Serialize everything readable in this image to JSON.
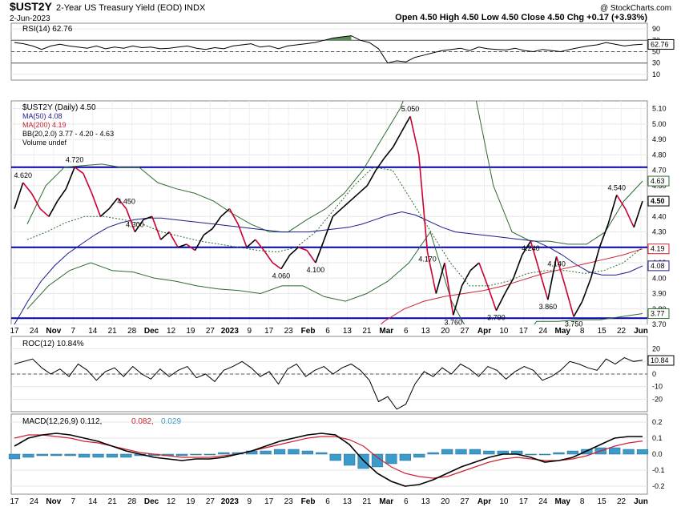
{
  "header": {
    "symbol": "$UST2Y",
    "name": "2-Year US Treasury Yield (EOD)",
    "exchange": "INDX",
    "date": "2-Jun-2023",
    "watermark": "@ StockCharts.com",
    "ohlc": "Open 4.50  High 4.50  Low 4.50  Close 4.50  Chg +0.17 (+3.93%)"
  },
  "legend": {
    "rsi": "RSI(14) 62.76",
    "price": "$UST2Y (Daily) 4.50",
    "ma50": "MA(50) 4.08",
    "ma200": "MA(200) 4.19",
    "bb": "BB(20,2.0) 3.77 - 4.20 - 4.63",
    "volume": "Volume undef",
    "roc": "ROC(12) 10.84%",
    "macd_label": "MACD(12,26,9) 0.112,",
    "macd_signal_val": "0.082,",
    "macd_hist_val": "0.029"
  },
  "colors": {
    "price": "#000000",
    "down": "#cc0033",
    "ma50": "#1a1a8c",
    "ma200": "#cc2233",
    "bb": "#2e6b2e",
    "hline": "#0000aa",
    "hist": "#3a9ccc",
    "rsi_fill": "#5a8a5a"
  },
  "x_axis": {
    "labels": [
      "17",
      "24",
      "Nov",
      "7",
      "14",
      "21",
      "28",
      "Dec",
      "12",
      "19",
      "27",
      "2023",
      "9",
      "17",
      "23",
      "Feb",
      "6",
      "13",
      "21",
      "Mar",
      "6",
      "13",
      "20",
      "27",
      "Apr",
      "10",
      "17",
      "24",
      "May",
      "8",
      "15",
      "22",
      "Jun"
    ],
    "bold": [
      "Nov",
      "Dec",
      "2023",
      "Feb",
      "Mar",
      "Apr",
      "May",
      "Jun"
    ]
  },
  "chart_data": [
    {
      "type": "line",
      "panel": "RSI",
      "y_ticks": [
        "90",
        "70",
        "50",
        "30",
        "10"
      ],
      "current": "62.76",
      "series": [
        {
          "name": "RSI(14)",
          "values": [
            66,
            64,
            60,
            54,
            60,
            63,
            60,
            58,
            56,
            60,
            55,
            58,
            56,
            60,
            57,
            58,
            55,
            56,
            58,
            60,
            56,
            54,
            57,
            55,
            60,
            62,
            64,
            58,
            60,
            55,
            60,
            62,
            64,
            66,
            70,
            74,
            76,
            78,
            70,
            66,
            55,
            30,
            34,
            32,
            40,
            44,
            48,
            52,
            54,
            56,
            52,
            58,
            55,
            54,
            53,
            56,
            52,
            50,
            54,
            52,
            50,
            54,
            57,
            60,
            62,
            66,
            63,
            60,
            62,
            63
          ]
        }
      ]
    },
    {
      "type": "line",
      "panel": "Price",
      "y_ticks": [
        "5.10",
        "5.00",
        "4.90",
        "4.80",
        "4.70",
        "4.60",
        "4.50",
        "4.40",
        "4.30",
        "4.20",
        "4.10",
        "4.00",
        "3.90",
        "3.80",
        "3.70"
      ],
      "ylim": [
        3.7,
        5.15
      ],
      "annotations": [
        {
          "text": "4.620",
          "y": 4.62
        },
        {
          "text": "4.720",
          "y": 4.72
        },
        {
          "text": "4.300",
          "y": 4.3
        },
        {
          "text": "4.450",
          "y": 4.45
        },
        {
          "text": "4.060",
          "y": 4.06
        },
        {
          "text": "5.050",
          "y": 5.05
        },
        {
          "text": "4.170",
          "y": 4.17
        },
        {
          "text": "4.100",
          "y": 4.1
        },
        {
          "text": "3.760",
          "y": 3.76
        },
        {
          "text": "3.790",
          "y": 3.79
        },
        {
          "text": "4.240",
          "y": 4.24
        },
        {
          "text": "4.140",
          "y": 4.14
        },
        {
          "text": "3.860",
          "y": 3.86
        },
        {
          "text": "3.750",
          "y": 3.75
        },
        {
          "text": "4.540",
          "y": 4.54
        }
      ],
      "horizontal_lines": [
        4.72,
        4.2,
        3.74
      ],
      "right_badges": [
        {
          "text": "4.63",
          "y": 4.63,
          "style": "bb"
        },
        {
          "text": "4.50",
          "y": 4.5,
          "style": "bold"
        },
        {
          "text": "4.19",
          "y": 4.19,
          "style": "ma200"
        },
        {
          "text": "4.08",
          "y": 4.08,
          "style": "ma50"
        },
        {
          "text": "3.77",
          "y": 3.77,
          "style": "bb"
        }
      ],
      "series": [
        {
          "name": "$UST2Y",
          "values": [
            4.45,
            4.62,
            4.55,
            4.45,
            4.4,
            4.5,
            4.58,
            4.72,
            4.68,
            4.55,
            4.4,
            4.45,
            4.52,
            4.45,
            4.3,
            4.38,
            4.4,
            4.25,
            4.3,
            4.2,
            4.22,
            4.18,
            4.28,
            4.32,
            4.4,
            4.45,
            4.35,
            4.2,
            4.25,
            4.18,
            4.1,
            4.06,
            4.15,
            4.2,
            4.18,
            4.1,
            4.25,
            4.4,
            4.45,
            4.5,
            4.55,
            4.6,
            4.7,
            4.78,
            4.85,
            4.95,
            5.05,
            4.8,
            4.17,
            3.9,
            4.1,
            3.76,
            3.95,
            4.05,
            4.1,
            3.95,
            3.79,
            3.9,
            4.0,
            4.15,
            4.24,
            4.05,
            3.86,
            4.14,
            3.95,
            3.75,
            3.85,
            4.0,
            4.2,
            4.35,
            4.54,
            4.45,
            4.33,
            4.5
          ]
        },
        {
          "name": "MA(50)",
          "values": [
            3.7,
            3.85,
            3.98,
            4.08,
            4.16,
            4.22,
            4.28,
            4.33,
            4.36,
            4.38,
            4.39,
            4.39,
            4.38,
            4.37,
            4.36,
            4.35,
            4.34,
            4.33,
            4.32,
            4.31,
            4.3,
            4.3,
            4.3,
            4.31,
            4.32,
            4.33,
            4.35,
            4.38,
            4.41,
            4.43,
            4.41,
            4.37,
            4.33,
            4.3,
            4.29,
            4.28,
            4.27,
            4.26,
            4.25,
            4.24,
            4.2,
            4.15,
            4.09,
            4.04,
            4.02,
            4.02,
            4.04,
            4.08
          ]
        },
        {
          "name": "MA(200)",
          "values": [
            3.6,
            3.72,
            3.8,
            3.85,
            3.88,
            3.9,
            3.92,
            3.95,
            3.99,
            4.03,
            4.06,
            4.09,
            4.12,
            4.15,
            4.19
          ]
        },
        {
          "name": "BB upper",
          "values": [
            4.35,
            4.6,
            4.72,
            4.73,
            4.74,
            4.72,
            4.72,
            4.62,
            4.58,
            4.55,
            4.5,
            4.42,
            4.35,
            4.3,
            4.3,
            4.38,
            4.45,
            4.55,
            4.7,
            4.9,
            5.1,
            5.4,
            5.6,
            5.5,
            5.2,
            4.6,
            4.3,
            4.24,
            4.24,
            4.22,
            4.22,
            4.3,
            4.5,
            4.63
          ]
        },
        {
          "name": "BB middle",
          "values": [
            4.25,
            4.3,
            4.36,
            4.4,
            4.4,
            4.38,
            4.35,
            4.3,
            4.27,
            4.24,
            4.22,
            4.2,
            4.18,
            4.17,
            4.2,
            4.3,
            4.45,
            4.6,
            4.72,
            4.7,
            4.5,
            4.3,
            4.1,
            3.95,
            3.95,
            3.98,
            4.03,
            4.05,
            4.05,
            4.03,
            4.05,
            4.1,
            4.2
          ]
        },
        {
          "name": "BB lower",
          "values": [
            3.8,
            3.95,
            4.05,
            4.1,
            4.05,
            4.04,
            4.0,
            3.98,
            3.95,
            3.93,
            3.92,
            3.9,
            3.95,
            3.95,
            3.88,
            3.85,
            3.9,
            3.98,
            4.1,
            4.3,
            3.85,
            3.6,
            3.4,
            3.5,
            3.72,
            3.72,
            3.73,
            3.73,
            3.75,
            3.77
          ]
        }
      ]
    },
    {
      "type": "line",
      "panel": "ROC",
      "y_ticks": [
        "20",
        "10",
        "0",
        "-10",
        "-20"
      ],
      "current": "10.84",
      "series": [
        {
          "name": "ROC(12)",
          "values": [
            8,
            10,
            12,
            5,
            0,
            4,
            -2,
            8,
            3,
            -5,
            2,
            5,
            -2,
            6,
            0,
            -4,
            4,
            -2,
            3,
            6,
            -3,
            0,
            -6,
            3,
            6,
            10,
            5,
            -2,
            2,
            -8,
            4,
            8,
            -2,
            3,
            6,
            0,
            5,
            8,
            3,
            -5,
            -22,
            -18,
            -28,
            -24,
            -8,
            2,
            -2,
            5,
            0,
            8,
            4,
            -2,
            6,
            3,
            -4,
            2,
            6,
            3,
            -5,
            -2,
            3,
            10,
            8,
            5,
            3,
            12,
            8,
            13,
            10,
            11
          ]
        }
      ]
    },
    {
      "type": "line",
      "panel": "MACD",
      "y_ticks": [
        "0.2",
        "0.1",
        "0.0",
        "-0.1",
        "-0.2"
      ],
      "series": [
        {
          "name": "MACD",
          "values": [
            0.05,
            0.1,
            0.12,
            0.13,
            0.12,
            0.1,
            0.08,
            0.05,
            0.02,
            0.0,
            -0.02,
            -0.03,
            -0.04,
            -0.03,
            -0.03,
            -0.02,
            0.0,
            0.02,
            0.05,
            0.08,
            0.1,
            0.12,
            0.13,
            0.12,
            0.06,
            -0.04,
            -0.12,
            -0.17,
            -0.2,
            -0.19,
            -0.16,
            -0.12,
            -0.08,
            -0.05,
            -0.02,
            0.0,
            0.0,
            -0.02,
            -0.05,
            -0.04,
            -0.02,
            0.02,
            0.06,
            0.1,
            0.11,
            0.11
          ]
        },
        {
          "name": "Signal",
          "values": [
            0.1,
            0.12,
            0.12,
            0.11,
            0.1,
            0.08,
            0.07,
            0.05,
            0.03,
            0.01,
            0.0,
            -0.01,
            -0.02,
            -0.02,
            -0.02,
            -0.01,
            0.0,
            0.02,
            0.04,
            0.06,
            0.08,
            0.1,
            0.11,
            0.11,
            0.09,
            0.05,
            -0.02,
            -0.08,
            -0.12,
            -0.14,
            -0.15,
            -0.14,
            -0.11,
            -0.08,
            -0.05,
            -0.03,
            -0.02,
            -0.03,
            -0.04,
            -0.04,
            -0.03,
            -0.01,
            0.02,
            0.05,
            0.07,
            0.082
          ]
        },
        {
          "name": "Histogram",
          "values": [
            -0.03,
            -0.02,
            -0.01,
            -0.01,
            -0.01,
            -0.02,
            -0.02,
            -0.02,
            -0.02,
            -0.01,
            -0.01,
            -0.01,
            -0.01,
            0.0,
            0.0,
            0.01,
            0.01,
            0.02,
            0.02,
            0.03,
            0.03,
            0.02,
            0.01,
            -0.04,
            -0.07,
            -0.09,
            -0.08,
            -0.06,
            -0.04,
            -0.02,
            0.01,
            0.03,
            0.03,
            0.03,
            0.02,
            0.02,
            0.02,
            0.0,
            0.0,
            0.01,
            0.02,
            0.03,
            0.04,
            0.04,
            0.03,
            0.029
          ]
        }
      ]
    }
  ]
}
